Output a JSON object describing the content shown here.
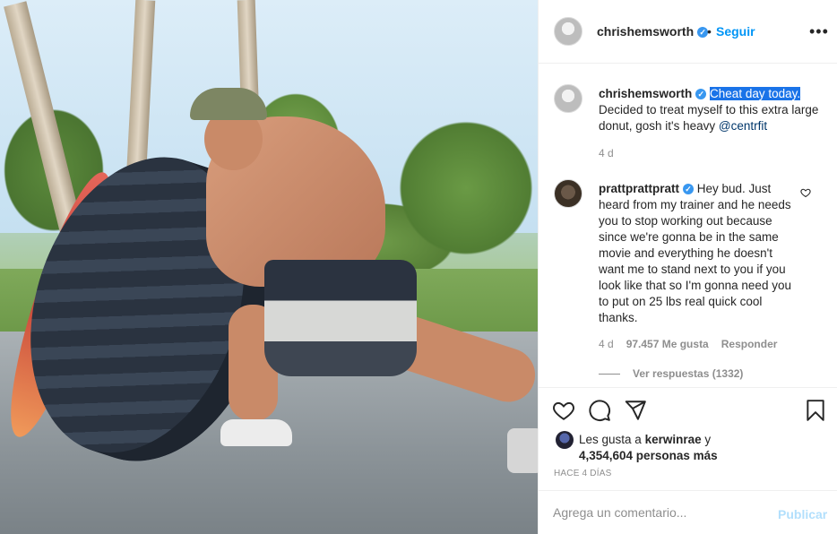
{
  "post": {
    "author": "chrishemsworth",
    "follow_dot": "•",
    "follow_label": "Seguir",
    "more_label": "•••"
  },
  "caption": {
    "author": "chrishemsworth",
    "highlight": "Cheat day today.",
    "body": " Decided to treat myself to this extra large donut, gosh it's heavy ",
    "mention": "@centrfit",
    "time": "4 d"
  },
  "comment": {
    "author": "prattprattpratt",
    "text": " Hey bud. Just heard from my trainer and he needs you to stop working out because since we're gonna be in the same movie and everything he doesn't want me to stand next to you if you look like that so I'm gonna need you to put on 25 lbs real quick cool thanks.",
    "time": "4 d",
    "likes": "97.457 Me gusta",
    "reply_label": "Responder",
    "view_replies": "Ver respuestas (1332)"
  },
  "likes": {
    "prefix": "Les gusta a ",
    "user": "kerwinrae",
    "joiner": " y",
    "others": "4,354,604 personas más"
  },
  "posted_ago": "HACE 4 DÍAS",
  "add_comment": {
    "placeholder": "Agrega un comentario...",
    "post_label": "Publicar"
  },
  "icons": [
    "heart-icon",
    "comment-icon",
    "share-icon",
    "bookmark-icon",
    "more-icon",
    "verified-icon"
  ],
  "colors": {
    "accent": "#0095f6",
    "verified": "#3897f0",
    "post_disabled": "#b2dffc",
    "selection": "#1a73e8"
  }
}
